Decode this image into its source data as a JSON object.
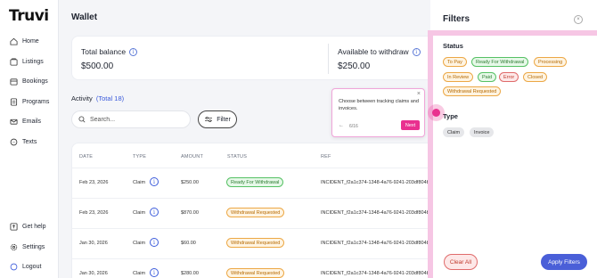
{
  "app": {
    "logo": "Truvi"
  },
  "sidebar": {
    "items": [
      {
        "label": "Home",
        "icon": "home-icon"
      },
      {
        "label": "Listings",
        "icon": "listings-icon"
      },
      {
        "label": "Bookings",
        "icon": "bookings-icon"
      },
      {
        "label": "Programs",
        "icon": "programs-icon"
      },
      {
        "label": "Emails",
        "icon": "email-icon"
      },
      {
        "label": "Texts",
        "icon": "texts-icon"
      }
    ],
    "bottom": [
      {
        "label": "Get help",
        "icon": "help-icon"
      },
      {
        "label": "Settings",
        "icon": "settings-icon"
      },
      {
        "label": "Logout",
        "icon": "logout-icon"
      }
    ]
  },
  "page": {
    "title": "Wallet",
    "total_balance_label": "Total balance",
    "total_balance_value": "$500.00",
    "available_label": "Available to withdraw",
    "available_value": "$250.00",
    "activity_label": "Activity",
    "activity_count": "(Total 18)",
    "search_placeholder": "Search...",
    "filter_label": "Filter"
  },
  "table": {
    "headers": [
      "DATE",
      "TYPE",
      "AMOUNT",
      "STATUS",
      "REF"
    ],
    "rows": [
      {
        "date": "Feb 23, 2026",
        "type": "Claim",
        "amount": "$250.00",
        "status": "Ready For Withdrawal",
        "ref": "INCIDENT_f2a1c374-1348-4a76-9241-203df804b"
      },
      {
        "date": "Feb 23, 2026",
        "type": "Claim",
        "amount": "$870.00",
        "status": "Withdrawal Requested",
        "ref": "INCIDENT_f2a1c374-1348-4a76-9241-203df804b"
      },
      {
        "date": "Jan 30, 2026",
        "type": "Claim",
        "amount": "$60.00",
        "status": "Withdrawal Requested",
        "ref": "INCIDENT_f2a1c374-1348-4a76-9241-203df804b"
      },
      {
        "date": "Jan 30, 2026",
        "type": "Claim",
        "amount": "$280.00",
        "status": "Withdrawal Requested",
        "ref": "INCIDENT_f2a1c374-1348-4a76-9241-203df804b"
      }
    ]
  },
  "tooltip": {
    "text": "Choose between tracking claims and invoices.",
    "step": "6/16",
    "next": "Next",
    "close": "×",
    "prev": "←"
  },
  "filters": {
    "title": "Filters",
    "status_label": "Status",
    "status_chips": [
      "To Pay",
      "Ready For Withdrawal",
      "Processing",
      "In Review",
      "Paid",
      "Error",
      "Closed",
      "Withdrawal Requested"
    ],
    "type_label": "Type",
    "type_chips": [
      "Claim",
      "Invoice"
    ],
    "clear_label": "Clear All",
    "apply_label": "Apply Filters"
  },
  "colors": {
    "accent": "#4a5fd8",
    "pink": "#e9308f",
    "link": "#3b5bdb"
  }
}
